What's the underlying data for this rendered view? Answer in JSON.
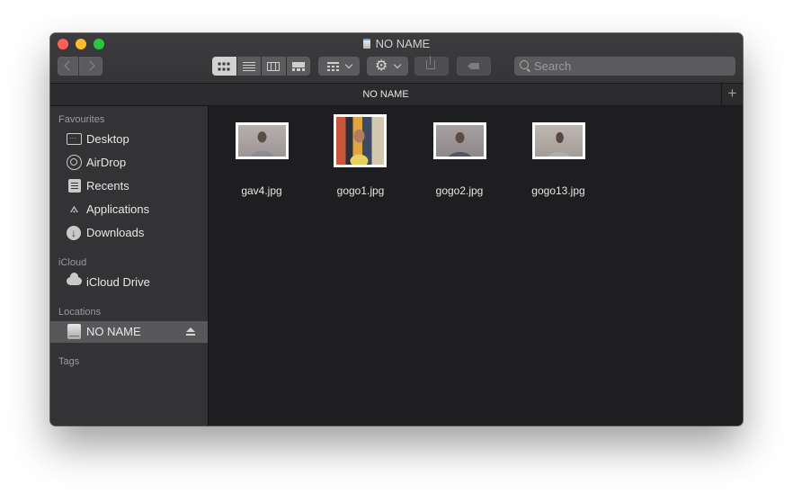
{
  "window": {
    "title": "NO NAME"
  },
  "toolbar": {
    "back_icon": "chevron-left-icon",
    "forward_icon": "chevron-right-icon",
    "view_modes": [
      {
        "name": "icon-view",
        "icon": "grid-icon",
        "active": true
      },
      {
        "name": "list-view",
        "icon": "list-icon",
        "active": false
      },
      {
        "name": "column-view",
        "icon": "columns-icon",
        "active": false
      },
      {
        "name": "gallery-view",
        "icon": "gallery-icon",
        "active": false
      }
    ],
    "group_icon": "group-grid-icon",
    "action_icon": "gear-icon",
    "share_icon": "share-icon",
    "tag_icon": "tag-icon",
    "search_placeholder": "Search"
  },
  "tabbar": {
    "label": "NO NAME",
    "add_label": "+"
  },
  "sidebar": {
    "sections": [
      {
        "heading": "Favourites",
        "items": [
          {
            "label": "Desktop",
            "icon": "desktop-icon"
          },
          {
            "label": "AirDrop",
            "icon": "airdrop-icon"
          },
          {
            "label": "Recents",
            "icon": "recents-icon"
          },
          {
            "label": "Applications",
            "icon": "applications-icon"
          },
          {
            "label": "Downloads",
            "icon": "downloads-icon"
          }
        ]
      },
      {
        "heading": "iCloud",
        "items": [
          {
            "label": "iCloud Drive",
            "icon": "cloud-icon"
          }
        ]
      },
      {
        "heading": "Locations",
        "items": [
          {
            "label": "NO NAME",
            "icon": "drive-icon",
            "selected": true,
            "eject": true
          }
        ]
      },
      {
        "heading": "Tags",
        "items": []
      }
    ]
  },
  "files": [
    {
      "name": "gav4.jpg"
    },
    {
      "name": "gogo1.jpg"
    },
    {
      "name": "gogo2.jpg"
    },
    {
      "name": "gogo13.jpg"
    }
  ],
  "colors": {
    "close": "#fe5f57",
    "minimize": "#febc2e",
    "maximize": "#28c840",
    "sidebar_bg": "#333335",
    "content_bg": "#1e1e20",
    "selection": "#58585a"
  }
}
